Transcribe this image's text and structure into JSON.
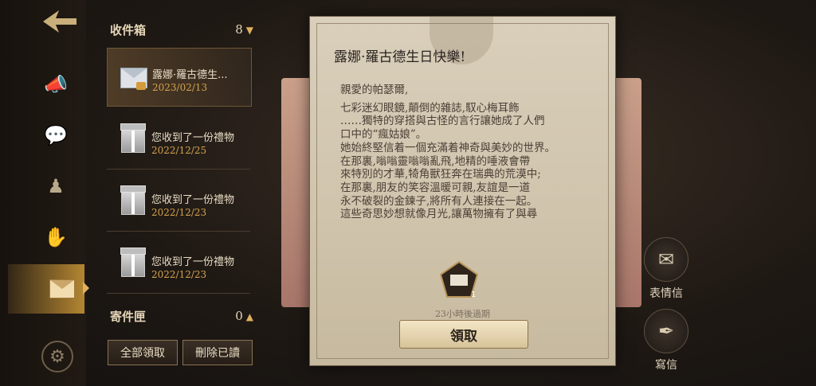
{
  "nav": {
    "items": [
      {
        "name": "announcement"
      },
      {
        "name": "chat"
      },
      {
        "name": "characters"
      },
      {
        "name": "gestures"
      },
      {
        "name": "mail",
        "active": true
      },
      {
        "name": "settings"
      }
    ]
  },
  "inbox": {
    "label": "收件箱",
    "count": "8",
    "items": [
      {
        "title": "露娜·羅古德生...",
        "date": "2023/02/13",
        "type": "letter",
        "selected": true
      },
      {
        "title": "您收到了一份禮物",
        "date": "2022/12/25",
        "type": "gift"
      },
      {
        "title": "您收到了一份禮物",
        "date": "2022/12/23",
        "type": "gift"
      },
      {
        "title": "您收到了一份禮物",
        "date": "2022/12/23",
        "type": "gift"
      }
    ]
  },
  "outbox": {
    "label": "寄件匣",
    "count": "0"
  },
  "buttons": {
    "claim_all": "全部領取",
    "delete_read": "刪除已讀"
  },
  "letter": {
    "title": "露娜·羅古德生日快樂!",
    "greeting": "親愛的帕瑟爾,",
    "lines": [
      "七彩迷幻眼鏡,顛倒的雜誌,馭心梅耳飾",
      "……獨特的穿搭與古怪的言行讓她成了人們",
      "口中的“瘋姑娘”。",
      "她始終堅信着一個充滿着神奇與美妙的世界。",
      "在那裏,嗡嗡靈嗡嗡亂飛,地精的唾液會帶",
      "來特別的才華,犄角獸狂奔在瑞典的荒漠中;",
      "在那裏,朋友的笑容溫暖可親,友誼是一道",
      "永不破裂的金鍊子,將所有人連接在一起。",
      "這些奇思妙想就像月光,讓萬物擁有了與尋"
    ],
    "reward_count": "1",
    "expire": "23小時後過期",
    "claim_label": "領取"
  },
  "actions": {
    "emote_letter": "表情信",
    "write_letter": "寫信"
  },
  "colors": {
    "accent": "#d3a24e",
    "paper": "#d9cfbb",
    "active_nav": "#e0b060"
  }
}
